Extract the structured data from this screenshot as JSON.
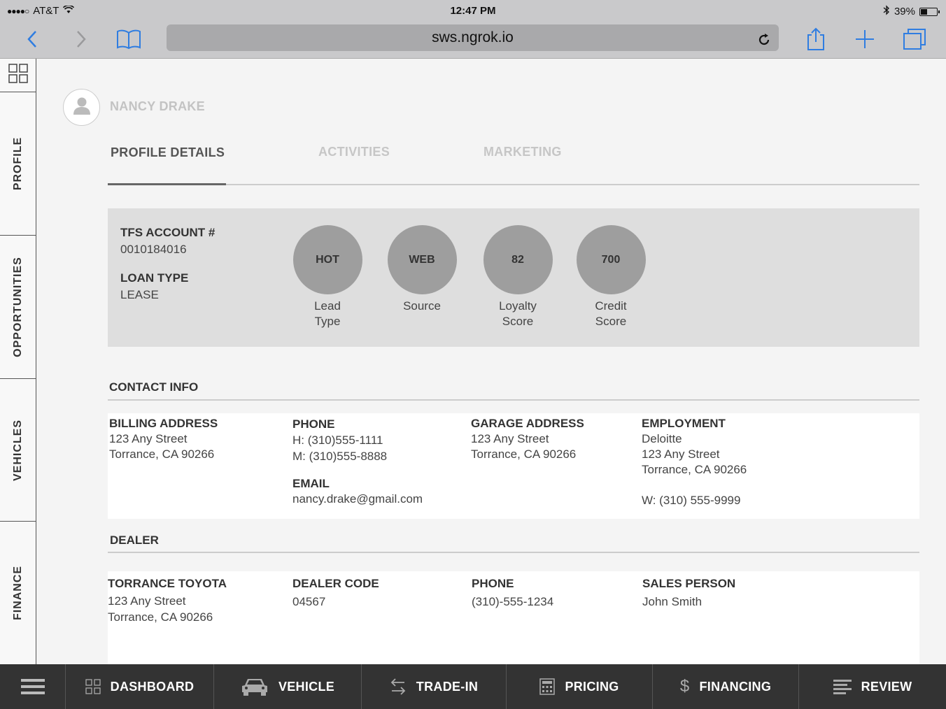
{
  "status_bar": {
    "carrier": "AT&T",
    "time": "12:47 PM",
    "battery": "39%",
    "battery_level": 0.39
  },
  "browser": {
    "url": "sws.ngrok.io"
  },
  "side_tabs": [
    {
      "label": "PROFILE"
    },
    {
      "label": "OPPORTUNITIES"
    },
    {
      "label": "VEHICLES"
    },
    {
      "label": "FINANCE"
    }
  ],
  "customer": {
    "name": "NANCY DRAKE"
  },
  "tabs": [
    {
      "label": "PROFILE DETAILS",
      "active": true
    },
    {
      "label": "ACTIVITIES",
      "active": false
    },
    {
      "label": "MARKETING",
      "active": false
    }
  ],
  "summary": {
    "account_label": "TFS ACCOUNT #",
    "account_value": "0010184016",
    "loan_label": "LOAN TYPE",
    "loan_value": "LEASE",
    "metrics": [
      {
        "value": "HOT",
        "caption": "Lead\nType"
      },
      {
        "value": "WEB",
        "caption": "Source"
      },
      {
        "value": "82",
        "caption": "Loyalty\nScore"
      },
      {
        "value": "700",
        "caption": "Credit\nScore"
      }
    ]
  },
  "contact": {
    "title": "CONTACT INFO",
    "billing": {
      "label": "BILLING ADDRESS",
      "line1": "123 Any Street",
      "line2": "Torrance, CA 90266"
    },
    "phone": {
      "label": "PHONE",
      "home": "H: (310)555-1111",
      "mobile": "M: (310)555-8888"
    },
    "email": {
      "label": "EMAIL",
      "value": "nancy.drake@gmail.com"
    },
    "garage": {
      "label": "GARAGE ADDRESS",
      "line1": "123 Any Street",
      "line2": "Torrance, CA 90266"
    },
    "employment": {
      "label": "EMPLOYMENT",
      "company": "Deloitte",
      "line1": "123 Any Street",
      "line2": "Torrance, CA 90266",
      "work_phone": "W: (310) 555-9999"
    }
  },
  "dealer": {
    "title": "DEALER",
    "name": "TORRANCE TOYOTA",
    "line1": "123 Any Street",
    "line2": "Torrance, CA 90266",
    "code_label": "DEALER CODE",
    "code": "04567",
    "phone_label": "PHONE",
    "phone": "(310)-555-1234",
    "sales_label": "SALES PERSON",
    "sales_person": "John Smith"
  },
  "bottom_nav": [
    {
      "label": "",
      "icon": "menu-icon"
    },
    {
      "label": "DASHBOARD",
      "icon": "grid-icon"
    },
    {
      "label": "VEHICLE",
      "icon": "car-icon"
    },
    {
      "label": "TRADE-IN",
      "icon": "swap-icon"
    },
    {
      "label": "PRICING",
      "icon": "calculator-icon"
    },
    {
      "label": "FINANCING",
      "icon": "dollar-icon"
    },
    {
      "label": "REVIEW",
      "icon": "list-icon"
    }
  ]
}
